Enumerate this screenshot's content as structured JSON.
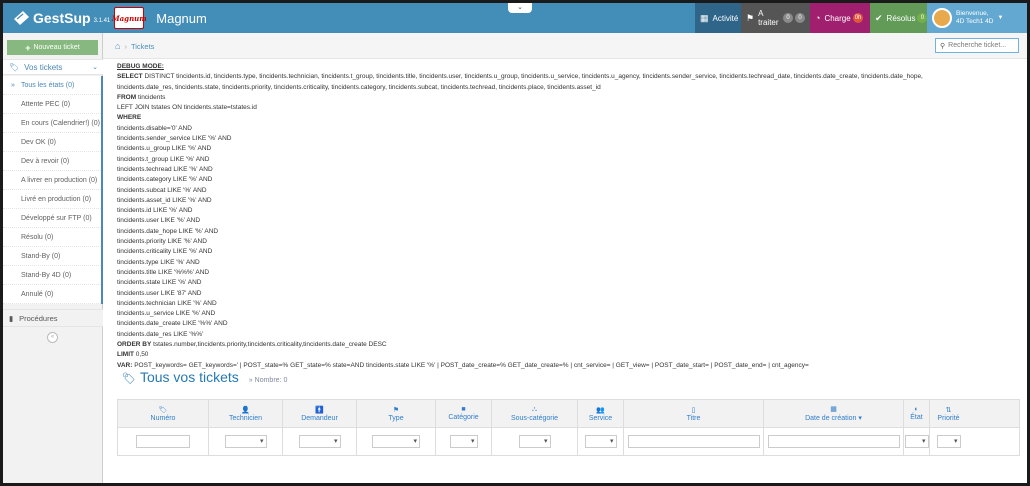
{
  "navbar": {
    "brand": "GestSup",
    "version": "3.1.41",
    "logo_text": "Magnum",
    "company": "Magnum",
    "toggle": "⌄",
    "activite": "Activité",
    "atraiter": "A traiter",
    "atraiter_badge1": "0",
    "atraiter_badge2": "0",
    "charge": "Charge",
    "charge_badge": "0h",
    "resolus": "Résolus",
    "resolus_badge": "0",
    "welcome": "Bienvenue,",
    "username": "4D Tech1 4D"
  },
  "sidebar": {
    "new_ticket": "Nouveau ticket",
    "vos_tickets": "Vos tickets",
    "items": [
      "Tous les états (0)",
      "Attente PEC (0)",
      "En cours (Calendrier!) (0)",
      "Dev OK (0)",
      "Dev à revoir (0)",
      "A livrer en production (0)",
      "Livré en production (0)",
      "Développé sur FTP (0)",
      "Résolu (0)",
      "Stand-By (0)",
      "Stand-By 4D (0)",
      "Annulé (0)"
    ],
    "procedures": "Procédures"
  },
  "breadcrumb": {
    "current": "Tickets"
  },
  "search": {
    "placeholder": "Recherche ticket..."
  },
  "debug": {
    "title": "DEBUG MODE:",
    "select_kw": "SELECT",
    "select_rest": " DISTINCT tincidents.id, tincidents.type, tincidents.technician, tincidents.t_group, tincidents.title, tincidents.user, tincidents.u_group, tincidents.u_service, tincidents.u_agency, tincidents.sender_service, tincidents.techread_date, tincidents.date_create, tincidents.date_hope,",
    "select_rest2": "tincidents.date_res, tincidents.state, tincidents.priority, tincidents.criticality, tincidents.category, tincidents.subcat, tincidents.techread, tincidents.place, tincidents.asset_id",
    "from_kw": "FROM",
    "from_rest": " tincidents",
    "join": "LEFT JOIN tstates ON tincidents.state=tstates.id",
    "where_kw": "WHERE",
    "conditions": [
      "tincidents.disable='0' AND",
      "tincidents.sender_service LIKE '%' AND",
      "tincidents.u_group LIKE '%' AND",
      "tincidents.t_group LIKE '%' AND",
      "tincidents.techread LIKE '%' AND",
      "tincidents.category LIKE '%' AND",
      "tincidents.subcat LIKE '%' AND",
      "tincidents.asset_id LIKE '%' AND",
      "tincidents.id LIKE '%' AND",
      "tincidents.user LIKE '%' AND",
      "tincidents.date_hope LIKE '%' AND",
      "tincidents.priority LIKE '%' AND",
      "tincidents.criticality LIKE '%' AND",
      "tincidents.type LIKE '%' AND",
      "tincidents.title LIKE '%%%' AND",
      "tincidents.state LIKE '%' AND",
      "tincidents.user LIKE '87' AND",
      "tincidents.technician LIKE '%' AND",
      "tincidents.u_service LIKE '%' AND",
      "tincidents.date_create LIKE '%%' AND",
      "tincidents.date_res LIKE '%%'"
    ],
    "order_kw": "ORDER BY",
    "order_rest": " tstates.number,tincidents.priority,tincidents.criticality,tincidents.date_create DESC",
    "limit_kw": "LIMIT",
    "limit_rest": " 0,50",
    "var_kw": "VAR:",
    "var_rest": " POST_keywords= GET_keywords=' | POST_state=% GET_state=% state=AND tincidents.state LIKE '%' | POST_date_create=% GET_date_create=% | cnt_service= | GET_view= | POST_date_start= | POST_date_end= | cnt_agency="
  },
  "main": {
    "title": "Tous vos tickets",
    "count_prefix": "»",
    "count": "Nombre: 0"
  },
  "table": {
    "columns": [
      {
        "label": "Numéro",
        "icon": "tag-icon",
        "glyph": "🏷"
      },
      {
        "label": "Technicien",
        "icon": "user-icon",
        "glyph": "👤"
      },
      {
        "label": "Demandeur",
        "icon": "male-icon",
        "glyph": "🚹"
      },
      {
        "label": "Type",
        "icon": "flag-icon",
        "glyph": "⚑"
      },
      {
        "label": "Catégorie",
        "icon": "square-icon",
        "glyph": "■"
      },
      {
        "label": "Sous-catégorie",
        "icon": "sitemap-icon",
        "glyph": "⛬"
      },
      {
        "label": "Service",
        "icon": "users-icon",
        "glyph": "👥"
      },
      {
        "label": "Titre",
        "icon": "file-icon",
        "glyph": "▯"
      },
      {
        "label": "Date de création ▾",
        "icon": "calendar-icon",
        "glyph": "▦"
      },
      {
        "label": "État",
        "icon": "adjust-icon",
        "glyph": "◐"
      },
      {
        "label": "Priorité",
        "icon": "sort-icon",
        "glyph": "⇅"
      }
    ]
  },
  "colors": {
    "navbar": "#438eb9",
    "accent": "#2679b5",
    "new_ticket": "#87b87f",
    "charge": "#a0206f",
    "resolus": "#629b58"
  }
}
